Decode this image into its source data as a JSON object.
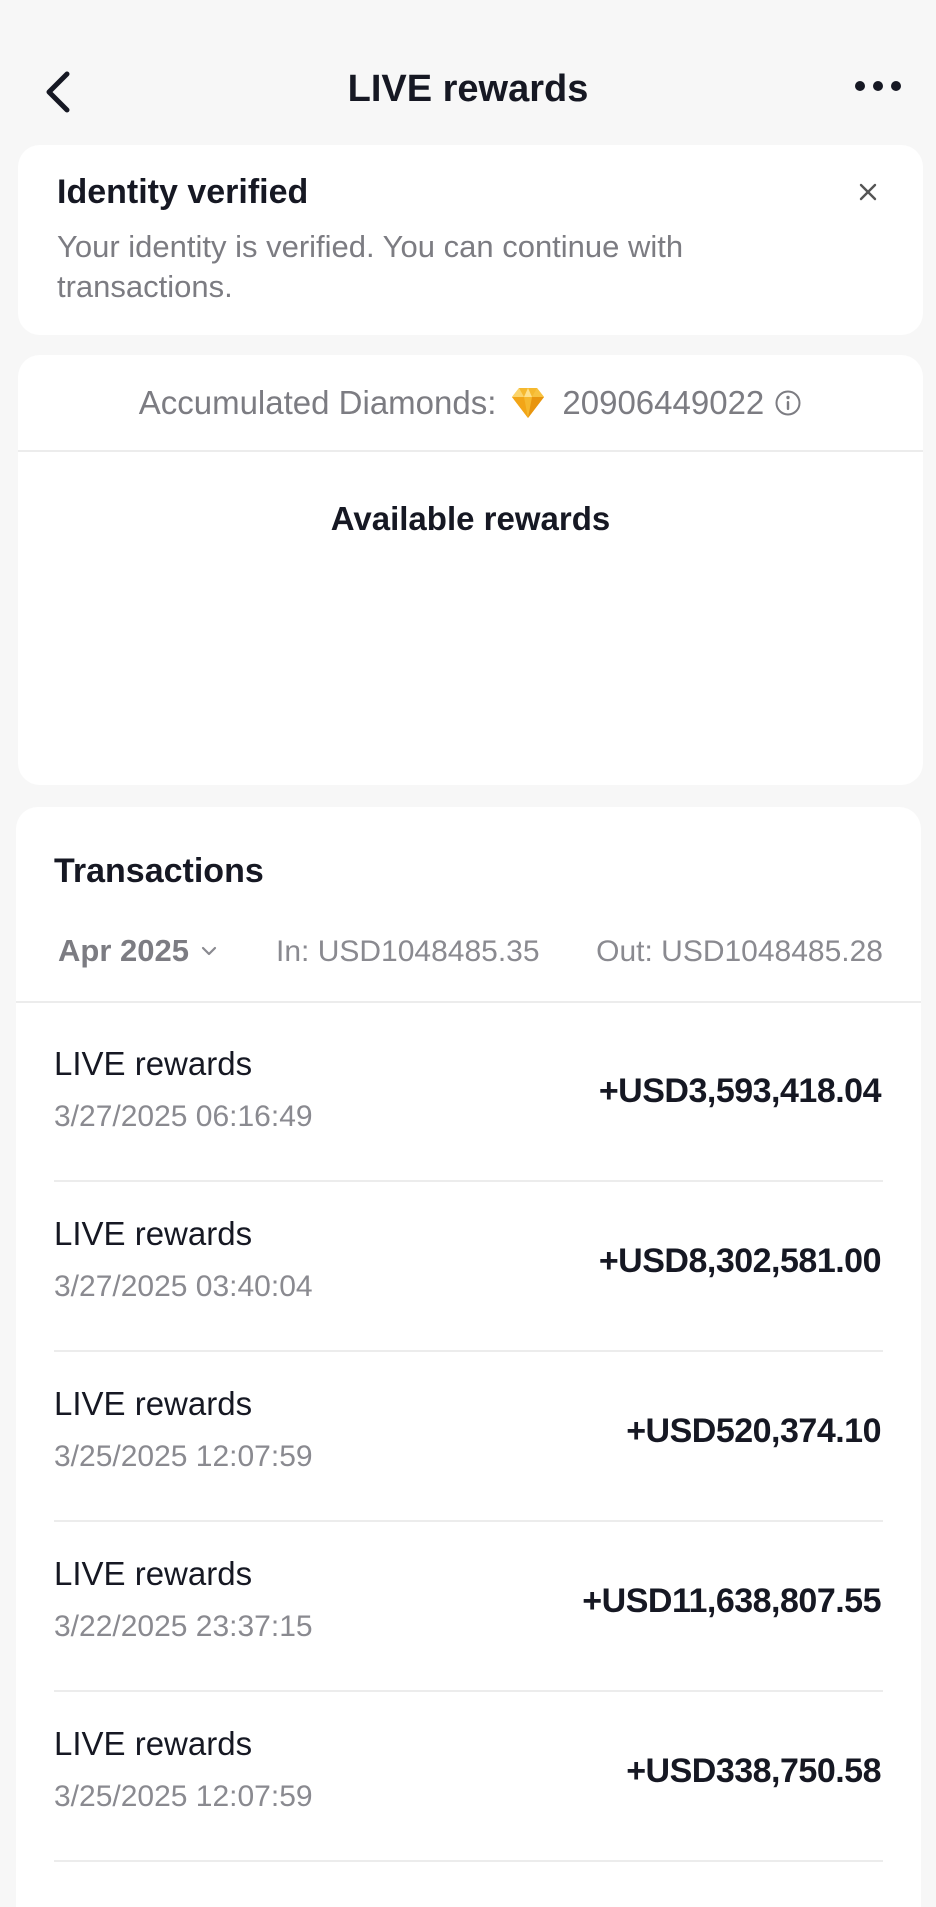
{
  "header": {
    "title": "LIVE rewards",
    "back_icon": "chevron-left-icon",
    "more_icon": "more-horizontal-icon"
  },
  "verification": {
    "title": "Identity verified",
    "message": "Your identity is verified. You can continue with transactions.",
    "close_icon": "close-icon"
  },
  "rewards": {
    "accumulated_label": "Accumulated Diamonds:",
    "accumulated_value": "20906449022",
    "diamond_icon": "diamond-icon",
    "info_icon": "info-icon",
    "available_title": "Available rewards"
  },
  "transactions": {
    "title": "Transactions",
    "month": "Apr 2025",
    "in_text": "In: USD1048485.35",
    "out_text": "Out: USD1048485.28",
    "items": [
      {
        "name": "LIVE rewards",
        "date": "3/27/2025 06:16:49",
        "amount": "+USD3,593,418.04"
      },
      {
        "name": "LIVE rewards",
        "date": "3/27/2025 03:40:04",
        "amount": "+USD8,302,581.00"
      },
      {
        "name": "LIVE rewards",
        "date": "3/25/2025 12:07:59",
        "amount": "+USD520,374.10"
      },
      {
        "name": "LIVE rewards",
        "date": "3/22/2025 23:37:15",
        "amount": "+USD11,638,807.55"
      },
      {
        "name": "LIVE rewards",
        "date": "3/25/2025 12:07:59",
        "amount": "+USD338,750.58"
      }
    ]
  },
  "colors": {
    "background": "#f7f7f7",
    "card": "#ffffff",
    "text_primary": "#161823",
    "text_secondary": "#8a8a90",
    "divider": "#ececec",
    "diamond": "#f5b82e"
  }
}
